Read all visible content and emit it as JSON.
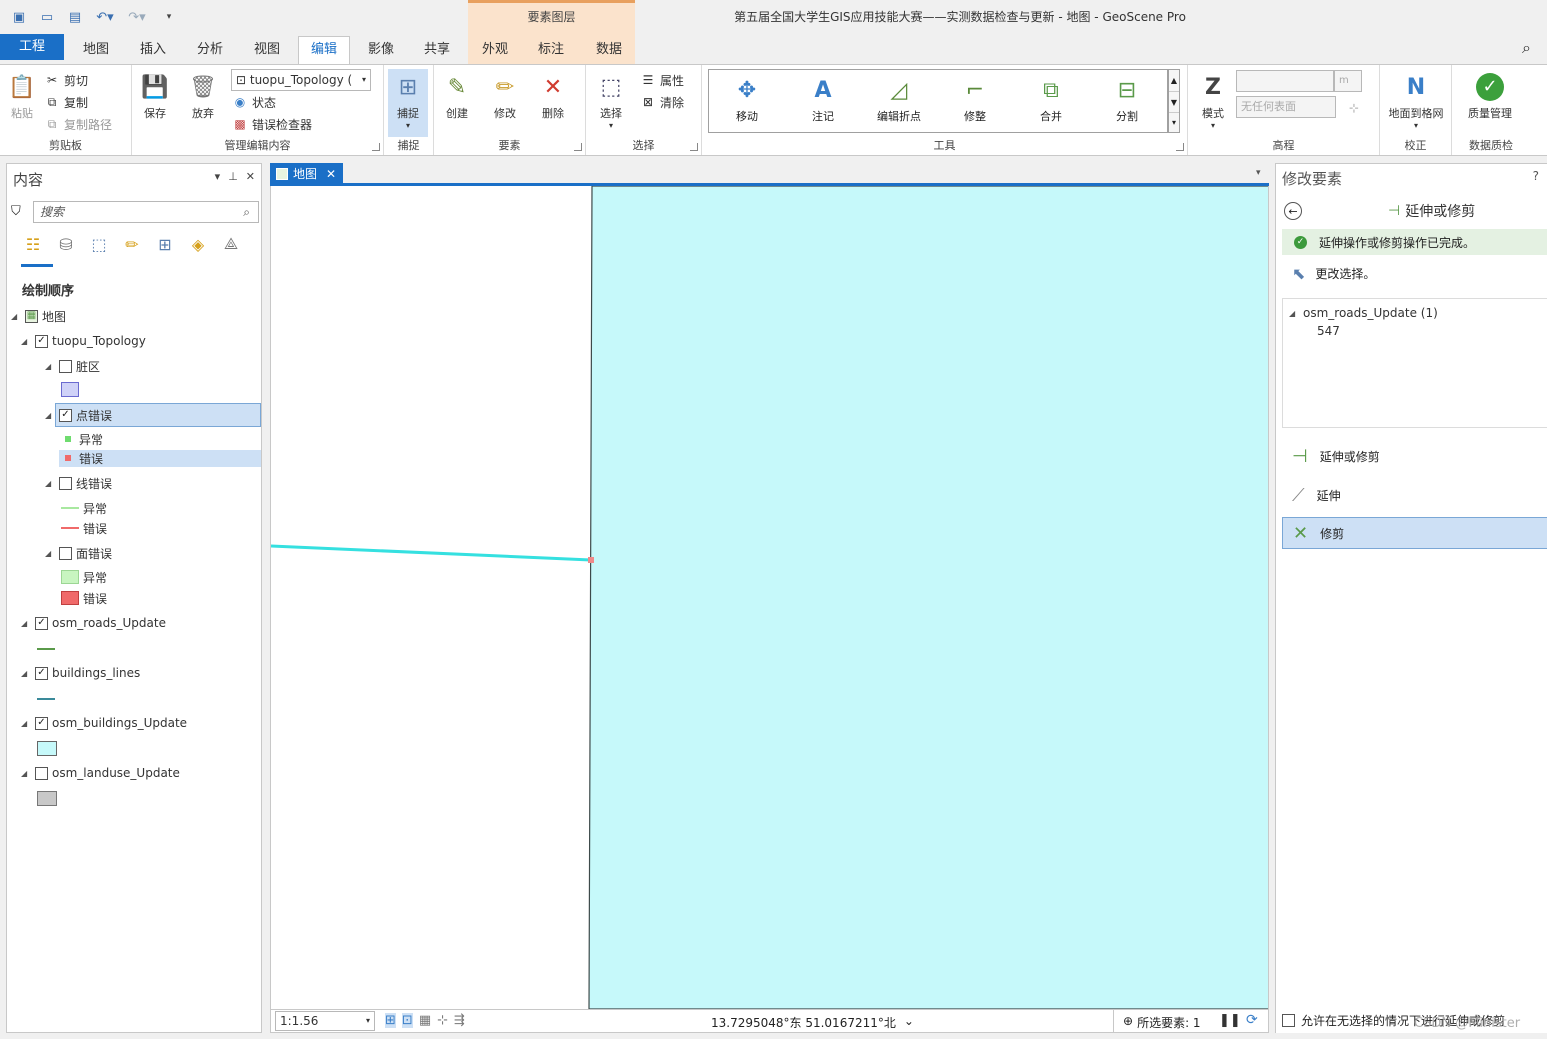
{
  "window": {
    "title": "第五届全国大学生GIS应用技能大赛——实测数据检查与更新 - 地图 - GeoScene Pro",
    "context_group": "要素图层"
  },
  "tabs": [
    "工程",
    "地图",
    "插入",
    "分析",
    "视图",
    "编辑",
    "影像",
    "共享",
    "外观",
    "标注",
    "数据"
  ],
  "active_tab": "编辑",
  "ribbon": {
    "clipboard": {
      "label": "剪贴板",
      "paste": "粘贴",
      "cut": "剪切",
      "copy": "复制",
      "copy_path": "复制路径"
    },
    "manage": {
      "label": "管理编辑内容",
      "save": "保存",
      "discard": "放弃",
      "topology": "tuopu_Topology (",
      "status": "状态",
      "error_inspector": "错误检查器"
    },
    "snapping": {
      "label": "捕捉",
      "snap": "捕捉"
    },
    "features": {
      "label": "要素",
      "create": "创建",
      "modify": "修改",
      "delete": "删除"
    },
    "selection": {
      "label": "选择",
      "select": "选择",
      "attributes": "属性",
      "clear": "清除"
    },
    "tools": {
      "label": "工具",
      "items": [
        "移动",
        "注记",
        "编辑折点",
        "修整",
        "合并",
        "分割"
      ]
    },
    "elevation": {
      "label": "高程",
      "mode": "模式",
      "unit": "m",
      "surface": "无任何表面"
    },
    "correction": {
      "label": "校正",
      "ground_to_grid": "地面到格网"
    },
    "quality": {
      "label": "数据质检",
      "quality_mgmt": "质量管理"
    }
  },
  "contents": {
    "title": "内容",
    "search_placeholder": "搜索",
    "draw_order": "绘制顺序",
    "map": "地图",
    "topology": "tuopu_Topology",
    "dirty_areas": "脏区",
    "point_errors": "点错误",
    "point_exception": "异常",
    "point_error": "错误",
    "line_errors": "线错误",
    "line_exception": "异常",
    "line_error": "错误",
    "polygon_errors": "面错误",
    "polygon_exception": "异常",
    "polygon_error": "错误",
    "layers": [
      "osm_roads_Update",
      "buildings_lines",
      "osm_buildings_Update",
      "osm_landuse_Update"
    ]
  },
  "map_tab": "地图",
  "status_bar": {
    "scale": "1:1.56",
    "coordinates": "13.7295048°东 51.0167211°北",
    "selected_features": "所选要素: 1"
  },
  "modify_pane": {
    "title": "修改要素",
    "help": "?",
    "tool_title": "延伸或修剪",
    "done_message": "延伸操作或修剪操作已完成。",
    "change_selection": "更改选择。",
    "selection_layer": "osm_roads_Update (1)",
    "selection_id": "547",
    "options": [
      "延伸或修剪",
      "延伸",
      "修剪"
    ],
    "active_option": "修剪",
    "allow_without_selection": "允许在无选择的情况下进行延伸或修剪"
  },
  "watermark": "CSDN @Minister",
  "colors": {
    "accent": "#1a6fc7",
    "building_fill": "#c6f9fa",
    "road_line": "#35e0e0",
    "point_exception": "#6fdc6f",
    "point_error": "#f06a6a",
    "polygon_exception": "#c8f5c0",
    "polygon_error": "#f06a6a"
  }
}
